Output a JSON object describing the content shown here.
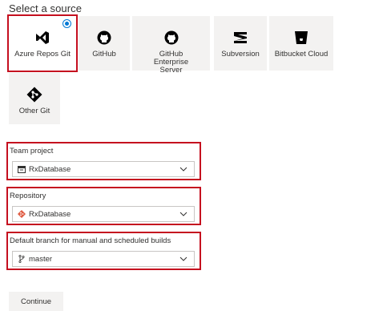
{
  "heading": "Select a source",
  "sources": [
    {
      "label": "Azure Repos Git",
      "icon": "azure-repos-icon",
      "selected": true
    },
    {
      "label": "GitHub",
      "icon": "github-icon",
      "selected": false
    },
    {
      "label": "GitHub Enterprise Server",
      "icon": "github-enterprise-icon",
      "selected": false
    },
    {
      "label": "Subversion",
      "icon": "subversion-icon",
      "selected": false
    },
    {
      "label": "Bitbucket Cloud",
      "icon": "bitbucket-icon",
      "selected": false
    },
    {
      "label": "Other Git",
      "icon": "other-git-icon",
      "selected": false
    }
  ],
  "team_project": {
    "label": "Team project",
    "value": "RxDatabase",
    "icon": "project-icon"
  },
  "repository": {
    "label": "Repository",
    "value": "RxDatabase",
    "icon": "git-repo-icon"
  },
  "branch": {
    "label": "Default branch for manual and scheduled builds",
    "value": "master",
    "icon": "branch-icon"
  },
  "continue_label": "Continue",
  "colors": {
    "accent": "#0078d4",
    "highlight": "#c50f1f",
    "tile_bg": "#f3f2f1",
    "git_orange": "#e05d44"
  }
}
